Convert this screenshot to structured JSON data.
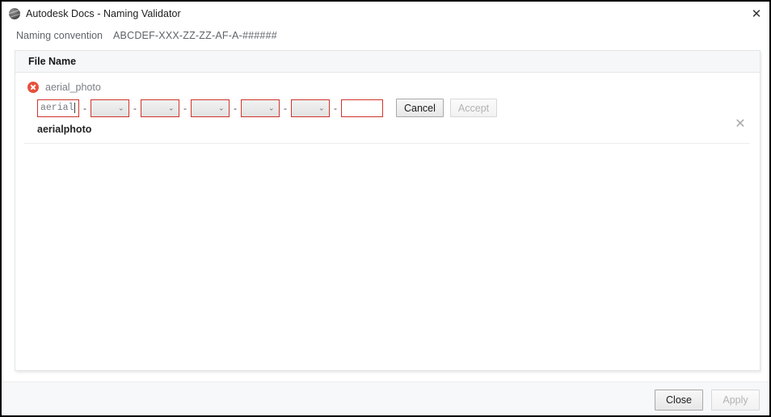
{
  "window": {
    "title": "Autodesk Docs - Naming Validator",
    "app_icon": "autodesk-sphere-icon",
    "close_icon": "✕"
  },
  "convention": {
    "label": "Naming convention",
    "value": "ABCDEF-XXX-ZZ-ZZ-AF-A-######"
  },
  "panel": {
    "header": "File Name",
    "entries": [
      {
        "status_icon": "error-icon",
        "filename": "aerial_photo",
        "fields": [
          {
            "type": "text",
            "value": "aerial",
            "has_caret": true
          },
          {
            "type": "select",
            "value": ""
          },
          {
            "type": "select",
            "value": ""
          },
          {
            "type": "select",
            "value": ""
          },
          {
            "type": "select",
            "value": ""
          },
          {
            "type": "select",
            "value": ""
          },
          {
            "type": "text",
            "value": "",
            "has_caret": false
          }
        ],
        "separator": "-",
        "cancel_label": "Cancel",
        "accept_label": "Accept",
        "accept_enabled": false,
        "remove_icon": "✕",
        "result": "aerialphoto"
      }
    ]
  },
  "footer": {
    "close_label": "Close",
    "apply_label": "Apply",
    "apply_enabled": false
  },
  "colors": {
    "error_red": "#e8503a",
    "field_border_red": "#d0342c",
    "panel_header_bg": "#f6f7f8",
    "footer_bg": "#f7f8fa"
  }
}
